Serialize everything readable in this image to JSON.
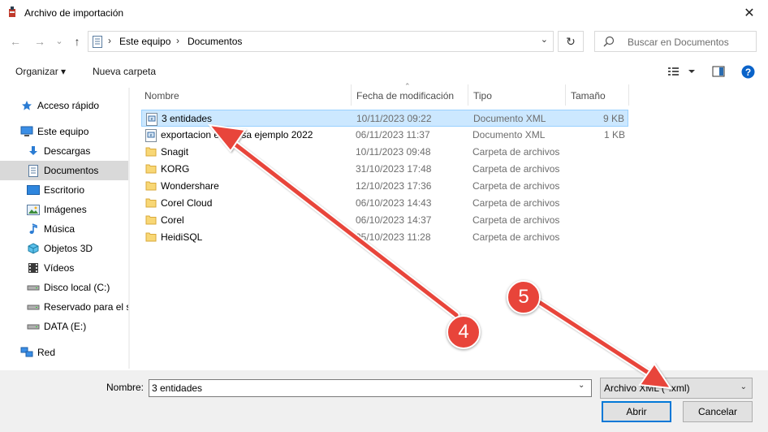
{
  "window": {
    "title": "Archivo de importación",
    "close_glyph": "✕"
  },
  "nav": {
    "back_glyph": "←",
    "forward_glyph": "→",
    "recent_glyph": "⌄",
    "up_glyph": "↑",
    "breadcrumbs": [
      "Este equipo",
      "Documentos"
    ],
    "refresh_glyph": "↻",
    "search_placeholder": "Buscar en Documentos"
  },
  "toolbar": {
    "organize_label": "Organizar",
    "new_folder_label": "Nueva carpeta",
    "dropdown_glyph": "▾"
  },
  "sidebar": {
    "items": [
      {
        "label": "Acceso rápido",
        "icon": "star-icon"
      },
      {
        "label": "Este equipo",
        "icon": "computer-icon"
      },
      {
        "label": "Descargas",
        "icon": "download-icon"
      },
      {
        "label": "Documentos",
        "icon": "document-icon"
      },
      {
        "label": "Escritorio",
        "icon": "desktop-icon"
      },
      {
        "label": "Imágenes",
        "icon": "image-icon"
      },
      {
        "label": "Música",
        "icon": "music-icon"
      },
      {
        "label": "Objetos 3D",
        "icon": "cube-icon"
      },
      {
        "label": "Vídeos",
        "icon": "video-icon"
      },
      {
        "label": "Disco local (C:)",
        "icon": "drive-icon"
      },
      {
        "label": "Reservado para el si",
        "icon": "drive-icon"
      },
      {
        "label": "DATA (E:)",
        "icon": "drive-icon"
      },
      {
        "label": "Red",
        "icon": "network-icon"
      }
    ]
  },
  "columns": {
    "name": "Nombre",
    "date": "Fecha de modificación",
    "type": "Tipo",
    "size": "Tamaño"
  },
  "files": [
    {
      "name": "3 entidades",
      "date": "10/11/2023 09:22",
      "type": "Documento XML",
      "size": "9 KB",
      "kind": "xml",
      "selected": true
    },
    {
      "name": "exportacion empresa ejemplo 2022",
      "date": "06/11/2023 11:37",
      "type": "Documento XML",
      "size": "1 KB",
      "kind": "xml",
      "selected": false
    },
    {
      "name": "Snagit",
      "date": "10/11/2023 09:48",
      "type": "Carpeta de archivos",
      "size": "",
      "kind": "folder",
      "selected": false
    },
    {
      "name": "KORG",
      "date": "31/10/2023 17:48",
      "type": "Carpeta de archivos",
      "size": "",
      "kind": "folder",
      "selected": false
    },
    {
      "name": "Wondershare",
      "date": "12/10/2023 17:36",
      "type": "Carpeta de archivos",
      "size": "",
      "kind": "folder",
      "selected": false
    },
    {
      "name": "Corel Cloud",
      "date": "06/10/2023 14:43",
      "type": "Carpeta de archivos",
      "size": "",
      "kind": "folder",
      "selected": false
    },
    {
      "name": "Corel",
      "date": "06/10/2023 14:37",
      "type": "Carpeta de archivos",
      "size": "",
      "kind": "folder",
      "selected": false
    },
    {
      "name": "HeidiSQL",
      "date": "05/10/2023 11:28",
      "type": "Carpeta de archivos",
      "size": "",
      "kind": "folder",
      "selected": false
    }
  ],
  "bottom": {
    "name_label": "Nombre:",
    "name_value": "3 entidades",
    "filter_value": "Archivo XML (*.xml)",
    "open_label": "Abrir",
    "cancel_label": "Cancelar"
  },
  "annotations": [
    {
      "label": "4"
    },
    {
      "label": "5"
    }
  ],
  "colors": {
    "annotation": "#e8443a",
    "selection": "#cce8ff",
    "accent": "#0078d7"
  }
}
